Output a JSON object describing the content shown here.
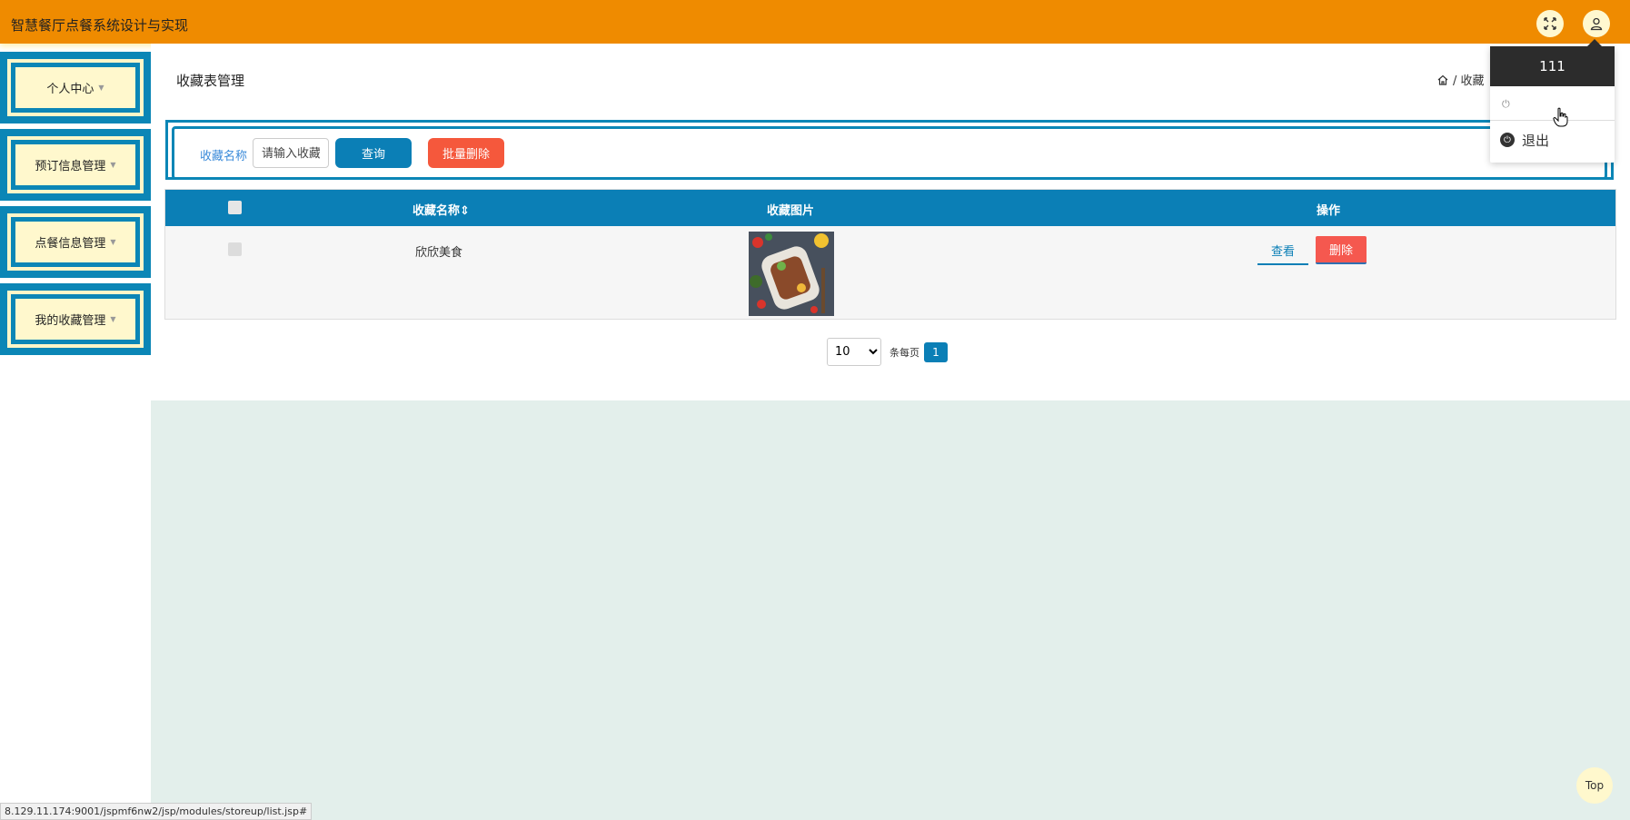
{
  "header": {
    "app_title": "智慧餐厅点餐系统设计与实现",
    "icons": [
      "fullscreen-icon",
      "user-icon"
    ]
  },
  "sidebar": {
    "items": [
      {
        "label": "个人中心"
      },
      {
        "label": "预订信息管理"
      },
      {
        "label": "点餐信息管理"
      },
      {
        "label": "我的收藏管理"
      }
    ]
  },
  "main": {
    "page_title": "收藏表管理",
    "breadcrumb": "/ 收藏",
    "search": {
      "label": "收藏名称",
      "placeholder": "请输入收藏",
      "query_button": "查询",
      "batch_delete_button": "批量删除"
    },
    "table": {
      "columns": [
        "收藏名称",
        "收藏图片",
        "操作"
      ],
      "rows": [
        {
          "name": "欣欣美食",
          "view": "查看",
          "delete": "删除"
        }
      ]
    },
    "pager": {
      "page_size": "10",
      "per_page_label": "条每页",
      "current_page": "1"
    }
  },
  "dropdown": {
    "username": "111",
    "logout_label": "退出"
  },
  "top_button": "Top",
  "status_url": "8.129.11.174:9001/jspmf6nw2/jsp/modules/storeup/list.jsp#",
  "colors": {
    "header": "#ef8b00",
    "primary": "#0b7fb6",
    "danger": "#f5583c",
    "sidebar_bg": "#fff8cd",
    "lower_bg": "#e3efeb"
  }
}
